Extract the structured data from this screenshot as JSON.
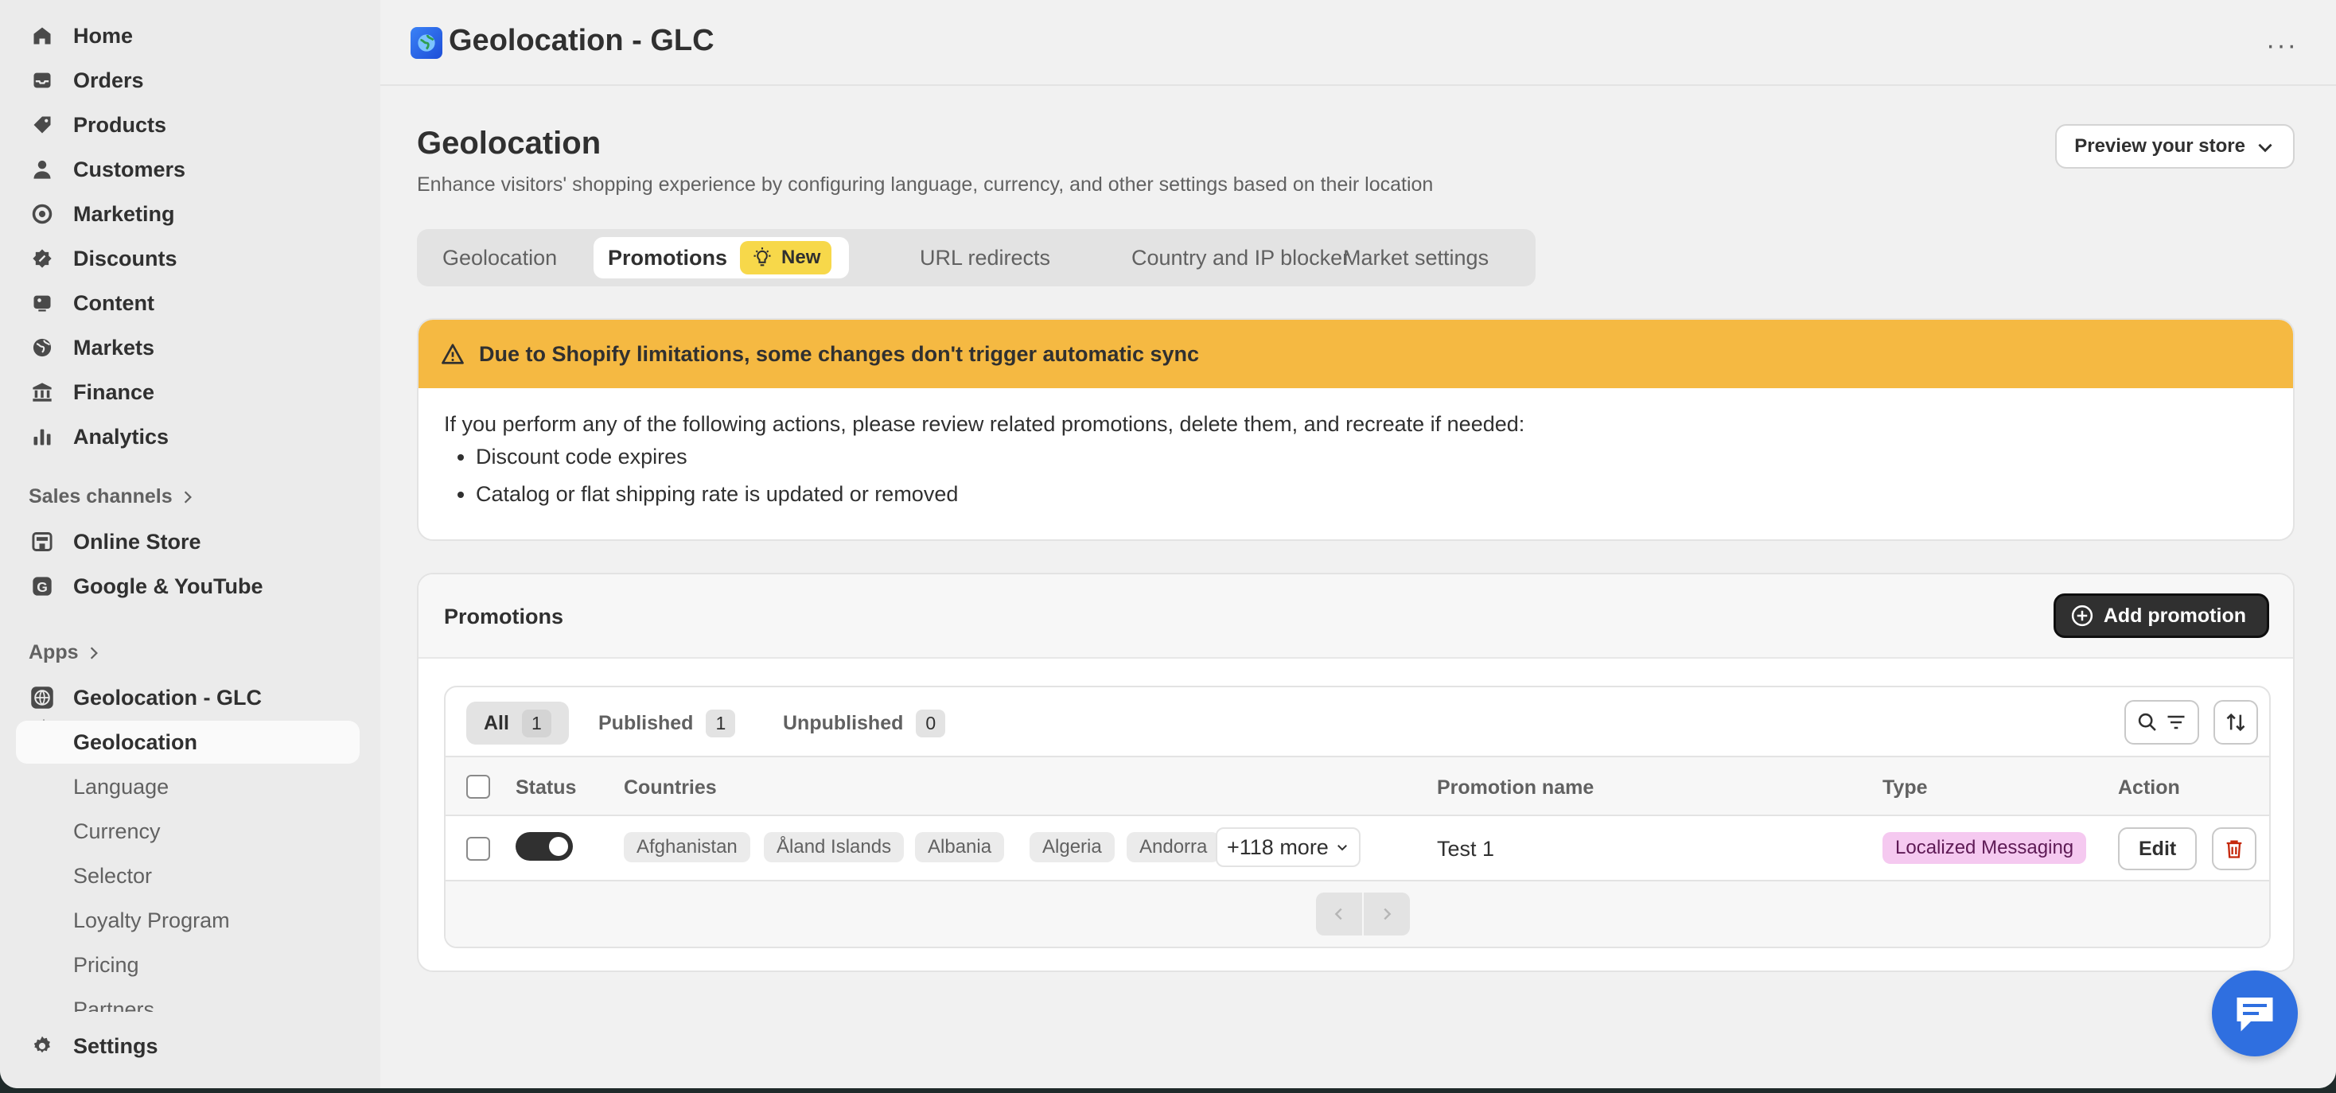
{
  "sidebar": {
    "nav": [
      {
        "label": "Home",
        "icon": "home-icon"
      },
      {
        "label": "Orders",
        "icon": "inbox-icon"
      },
      {
        "label": "Products",
        "icon": "tag-icon"
      },
      {
        "label": "Customers",
        "icon": "person-icon"
      },
      {
        "label": "Marketing",
        "icon": "target-icon"
      },
      {
        "label": "Discounts",
        "icon": "discount-icon"
      },
      {
        "label": "Content",
        "icon": "image-icon"
      },
      {
        "label": "Markets",
        "icon": "globe-icon"
      },
      {
        "label": "Finance",
        "icon": "bank-icon"
      },
      {
        "label": "Analytics",
        "icon": "bar-chart-icon"
      }
    ],
    "sales_channels_label": "Sales channels",
    "channels": [
      {
        "label": "Online Store",
        "icon": "store-icon"
      },
      {
        "label": "Google & YouTube",
        "icon": "google-icon"
      }
    ],
    "apps_label": "Apps",
    "app": {
      "label": "Geolocation - GLC",
      "icon": "globe-app-icon"
    },
    "app_subitems": [
      "Geolocation",
      "Language",
      "Currency",
      "Selector",
      "Loyalty Program",
      "Pricing",
      "Partners"
    ],
    "active_subitem": "Geolocation",
    "settings_label": "Settings"
  },
  "topbar": {
    "title": "Geolocation - GLC",
    "more_label": "···"
  },
  "page": {
    "title": "Geolocation",
    "subtitle": "Enhance visitors' shopping experience by configuring language, currency, and other settings based on their location",
    "preview_button": "Preview your store"
  },
  "tabs": [
    {
      "label": "Geolocation"
    },
    {
      "label": "Promotions",
      "badge": "New",
      "active": true
    },
    {
      "label": "URL redirects"
    },
    {
      "label": "Country and IP blocker"
    },
    {
      "label": "Market settings"
    }
  ],
  "banner": {
    "heading": "Due to Shopify limitations, some changes don't trigger automatic sync",
    "intro": "If you perform any of the following actions, please review related promotions, delete them, and recreate if needed:",
    "items": [
      "Discount code expires",
      "Catalog or flat shipping rate is updated or removed"
    ],
    "color": "#f5b942"
  },
  "promotions": {
    "title": "Promotions",
    "add_button": "Add promotion",
    "filters": [
      {
        "label": "All",
        "count": "1",
        "active": true
      },
      {
        "label": "Published",
        "count": "1"
      },
      {
        "label": "Unpublished",
        "count": "0"
      }
    ],
    "columns": {
      "status": "Status",
      "countries": "Countries",
      "name": "Promotion name",
      "type": "Type",
      "action": "Action"
    },
    "rows": [
      {
        "status_on": true,
        "countries": [
          "Afghanistan",
          "Åland Islands",
          "Albania",
          "Algeria",
          "Andorra"
        ],
        "more": "+118 more",
        "name": "Test 1",
        "type": "Localized Messaging",
        "edit": "Edit"
      }
    ]
  },
  "colors": {
    "primary_button": "#303030",
    "type_badge": "#f5c9f0",
    "new_badge": "#f7d84a",
    "chat_bubble": "#2f6fe0"
  }
}
